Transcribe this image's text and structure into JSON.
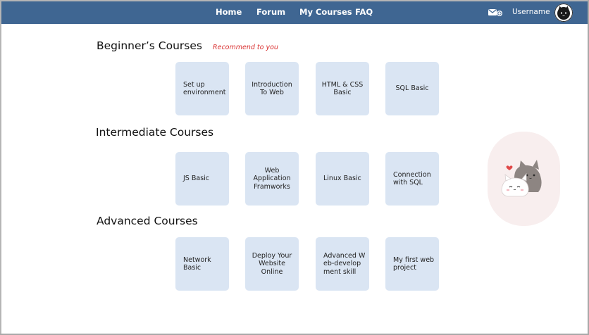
{
  "nav": {
    "links": [
      "Home",
      "Forum",
      "My Courses",
      "FAQ"
    ],
    "username": "Username",
    "colors": {
      "bar": "#3f6692",
      "text": "#ffffff"
    }
  },
  "sections": {
    "beginner": {
      "title": "Beginner’s Courses",
      "tag": "Recommend to you",
      "courses": [
        "Set up environment",
        "Introduction To Web",
        "HTML & CSS Basic",
        "SQL Basic"
      ]
    },
    "intermediate": {
      "title": "Intermediate Courses",
      "courses": [
        "JS Basic",
        "Web Application Framworks",
        "Linux Basic",
        "Connection with SQL"
      ]
    },
    "advanced": {
      "title": "Advanced Courses",
      "courses": [
        "Network Basic",
        "Deploy Your Website Online",
        "Advanced Web-development skill",
        "My first web project"
      ]
    }
  },
  "theme": {
    "card_bg": "#dae5f3",
    "accent_red": "#d93030",
    "mascot_bg": "#f8eeee"
  },
  "icons": [
    "mail-icon",
    "notification-badge-icon",
    "cat-avatar-icon",
    "cat-mascot-icon",
    "heart-icon"
  ]
}
